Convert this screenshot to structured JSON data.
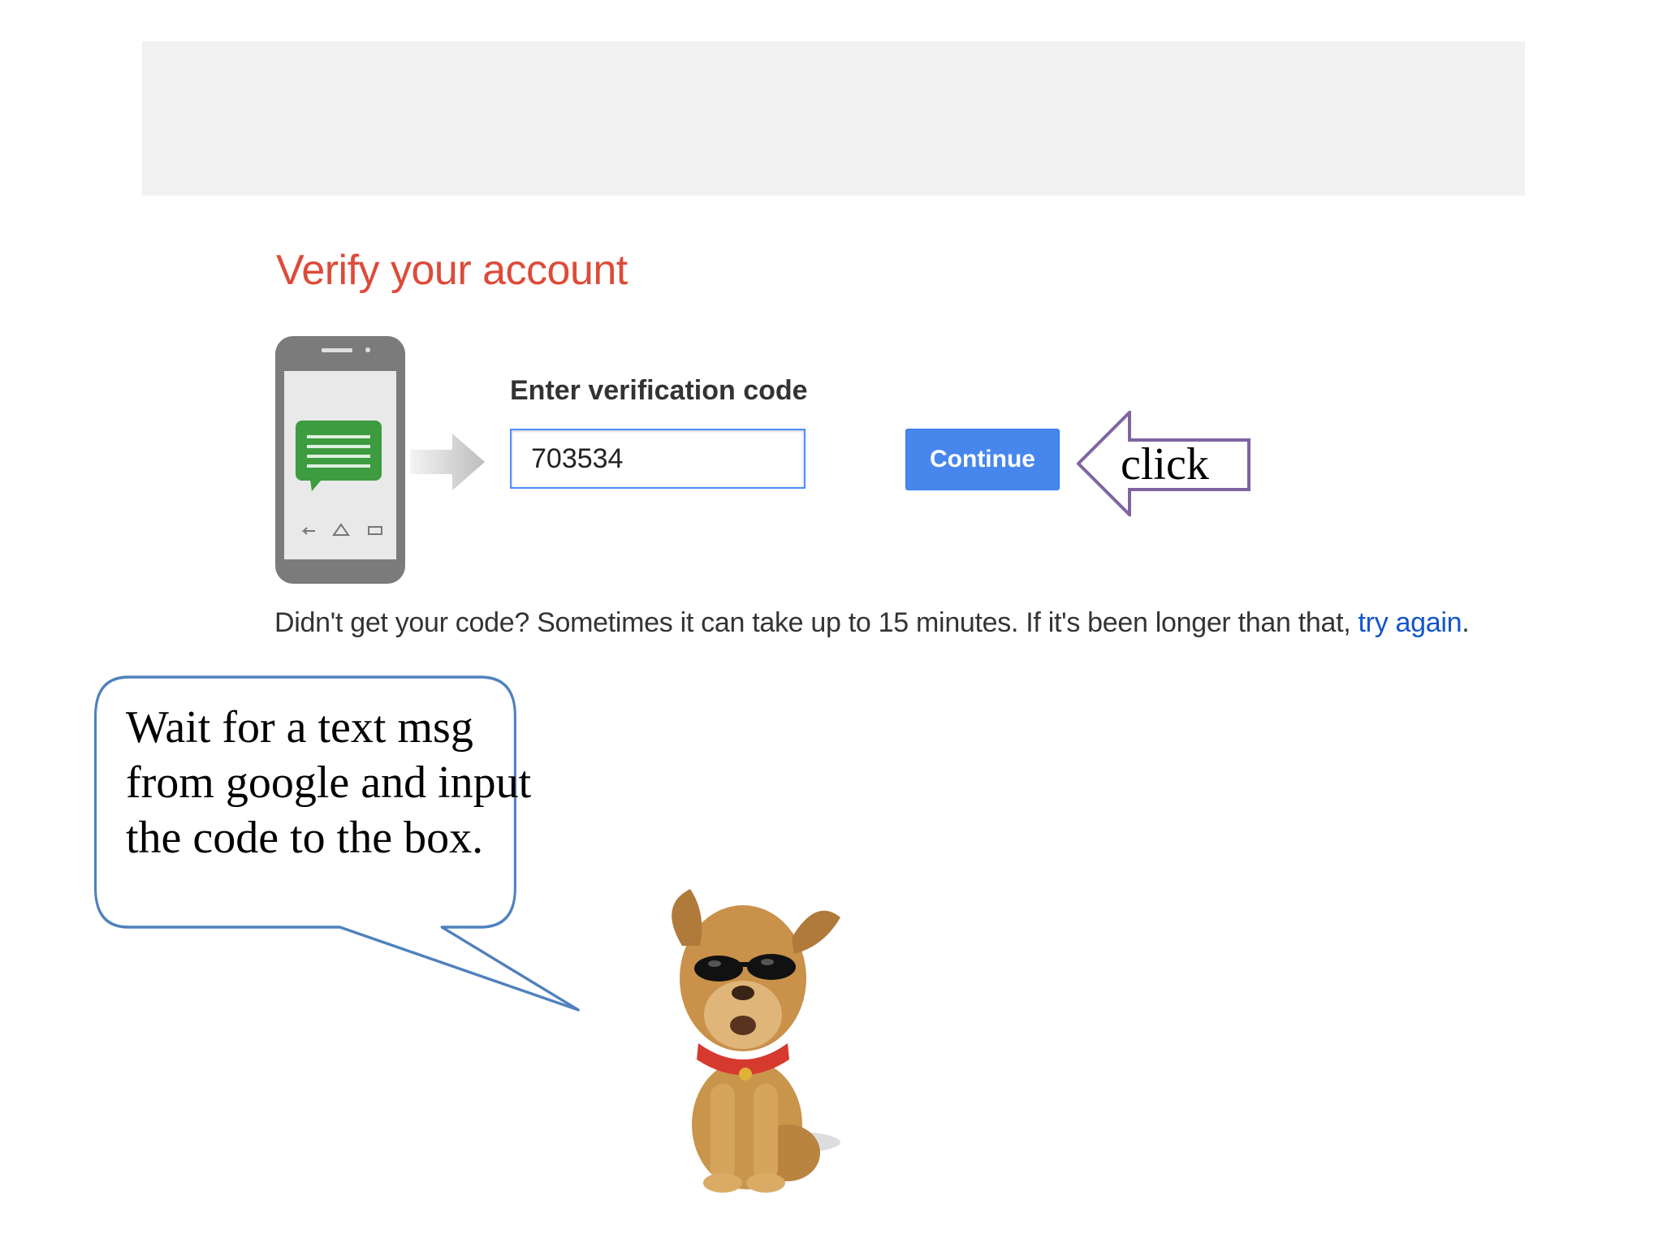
{
  "header": {
    "title": "Verify your account"
  },
  "form": {
    "label": "Enter verification code",
    "code_value": "703534",
    "continue_label": "Continue"
  },
  "help": {
    "text": "Didn't get your code? Sometimes it can take up to 15 minutes. If it's been longer than that, ",
    "link_text": "try again",
    "period": "."
  },
  "annotation": {
    "click_label": "click",
    "bubble_text": "Wait for a text msg from google and input the code to the box."
  },
  "icons": {
    "phone": "phone-sms-icon",
    "arrow": "right-arrow-icon",
    "mascot": "dog-with-sunglasses"
  },
  "colors": {
    "title": "#dd4b39",
    "button": "#4787ed",
    "input_border": "#4d90fe",
    "link": "#1155cc",
    "callout_border": "#8064a2",
    "bubble_border": "#4f81bd",
    "sms_green": "#3d9b40",
    "header_bg": "#f1f1f1"
  }
}
